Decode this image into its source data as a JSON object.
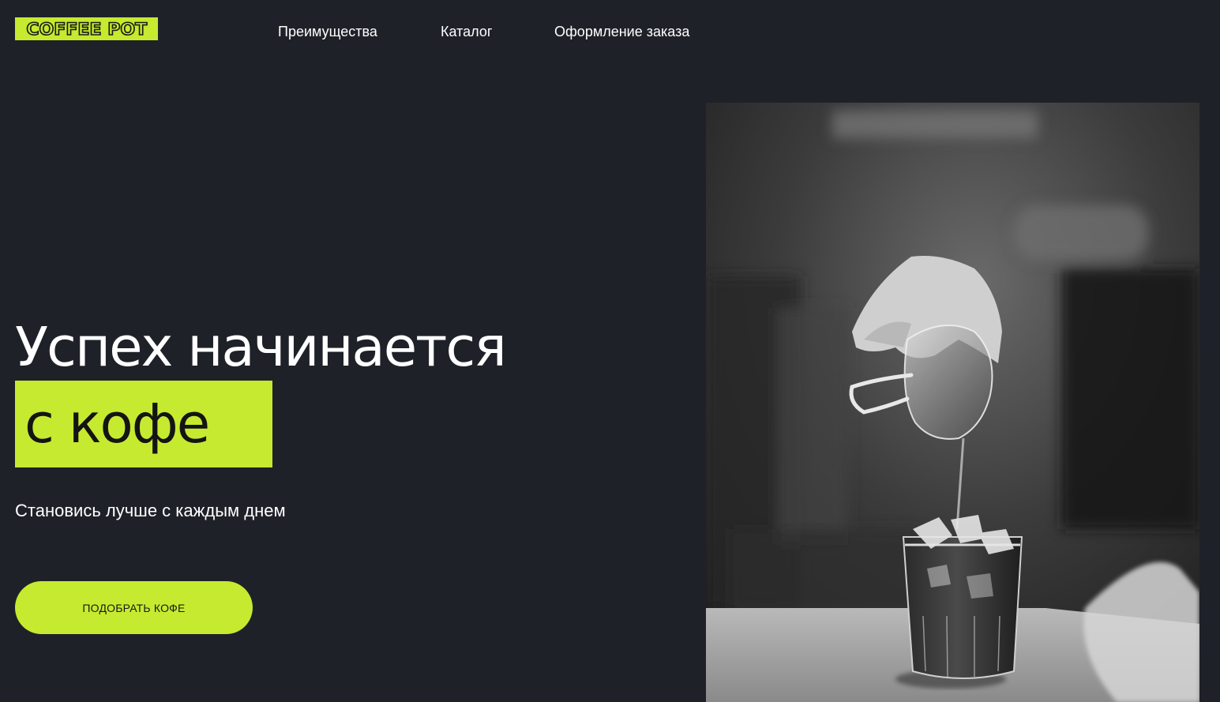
{
  "header": {
    "logo_text": "COFFEE POT",
    "nav": [
      {
        "label": "Преимущества"
      },
      {
        "label": "Каталог"
      },
      {
        "label": "Оформление заказа"
      }
    ]
  },
  "hero": {
    "title_line1": "Успех начинается",
    "title_line2": "с кофе",
    "subtitle": "Становись лучше с каждым днем",
    "cta_label": "ПОДОБРАТЬ КОФЕ"
  },
  "colors": {
    "background": "#1f2129",
    "accent": "#c6ea2f",
    "text": "#ffffff"
  },
  "icons": {
    "photo": "barista-pouring-iced-coffee-photo"
  }
}
